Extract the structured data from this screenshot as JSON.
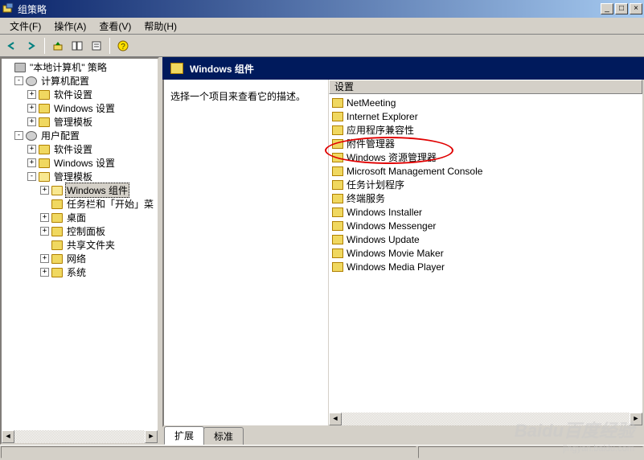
{
  "title": "组策略",
  "menus": [
    "文件(F)",
    "操作(A)",
    "查看(V)",
    "帮助(H)"
  ],
  "tree": {
    "root": "\"本地计算机\" 策略",
    "computer": {
      "label": "计算机配置",
      "children": [
        "软件设置",
        "Windows 设置",
        "管理模板"
      ]
    },
    "user": {
      "label": "用户配置",
      "software": "软件设置",
      "windows": "Windows 设置",
      "admin": {
        "label": "管理模板",
        "wincomp": "Windows 组件",
        "taskbar": "任务栏和「开始」菜",
        "desktop": "桌面",
        "control": "控制面板",
        "shared": "共享文件夹",
        "network": "网络",
        "system": "系统"
      }
    }
  },
  "header": "Windows 组件",
  "description": "选择一个项目来查看它的描述。",
  "column_header": "设置",
  "items": [
    "NetMeeting",
    "Internet Explorer",
    "应用程序兼容性",
    "附件管理器",
    "Windows 资源管理器",
    "Microsoft Management Console",
    "任务计划程序",
    "终端服务",
    "Windows Installer",
    "Windows Messenger",
    "Windows Update",
    "Windows Movie Maker",
    "Windows Media Player"
  ],
  "tabs": [
    "扩展",
    "标准"
  ],
  "watermark": "Baidu百度经验",
  "watermark2": "jingyan.baidu.com"
}
